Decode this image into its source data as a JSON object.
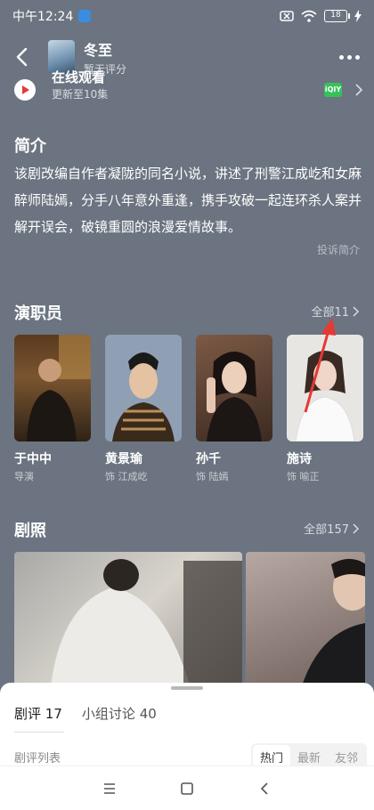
{
  "status": {
    "time": "中午12:24",
    "battery": "18"
  },
  "header": {
    "title": "冬至",
    "subtitle": "暂无评分"
  },
  "watch": {
    "label": "在线观看",
    "sub": "更新至10集",
    "provider": "iQIY"
  },
  "intro": {
    "title": "简介",
    "text": "该剧改编自作者凝陇的同名小说，讲述了刑警江成屹和女麻醉师陆嫣，分手八年意外重逢，携手攻破一起连环杀人案并解开误会，破镜重圆的浪漫爱情故事。",
    "complaint": "投诉简介"
  },
  "cast": {
    "title": "演职员",
    "more": "全部11",
    "members": [
      {
        "name": "于中中",
        "role": "导演"
      },
      {
        "name": "黄景瑜",
        "role": "饰 江成屹"
      },
      {
        "name": "孙千",
        "role": "饰 陆嫣"
      },
      {
        "name": "施诗",
        "role": "饰 喻正"
      }
    ]
  },
  "stills": {
    "title": "剧照",
    "more": "全部157"
  },
  "sheet": {
    "tab_reviews": "剧评",
    "reviews_count": "17",
    "tab_groups": "小组讨论",
    "groups_count": "40",
    "list_label": "剧评列表",
    "sort_options": [
      "热门",
      "最新",
      "友邻"
    ]
  },
  "colors": {
    "background": "#6b7480",
    "annotation_arrow": "#e53935"
  }
}
